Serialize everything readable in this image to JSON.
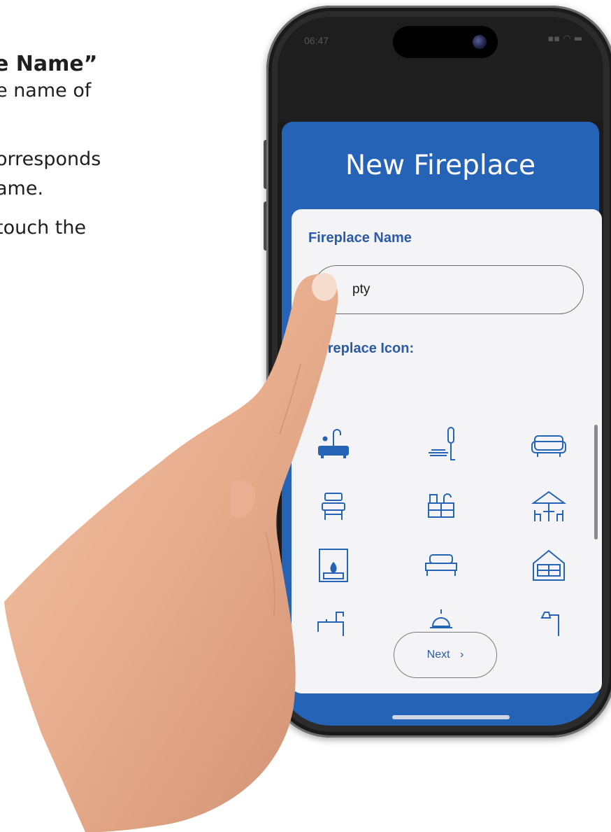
{
  "instructions": {
    "line1": "e Name”",
    "line2": "e name of",
    "line3": "orresponds",
    "line4": "ame.",
    "line5": "touch the"
  },
  "status_bar": {
    "time": "06:47",
    "icons": "▪▪ ◠ ▬"
  },
  "app": {
    "title": "New Fireplace",
    "field_label": "Fireplace Name",
    "name_value": "pty",
    "icon_section_label": "Fireplace Icon:",
    "next_label": "Next",
    "next_chevron": "›"
  },
  "icons": [
    "bathtub-icon",
    "shower-icon",
    "sofa-icon",
    "chair-icon",
    "cabinet-icon",
    "patio-umbrella-icon",
    "fireplace-icon",
    "bed-icon",
    "house-icon",
    "sink-icon",
    "ceiling-lamp-icon",
    "lamp-icon"
  ],
  "colors": {
    "header_blue": "#2563b6",
    "label_blue": "#2b5aa6",
    "card_bg": "#f4f4f6"
  }
}
